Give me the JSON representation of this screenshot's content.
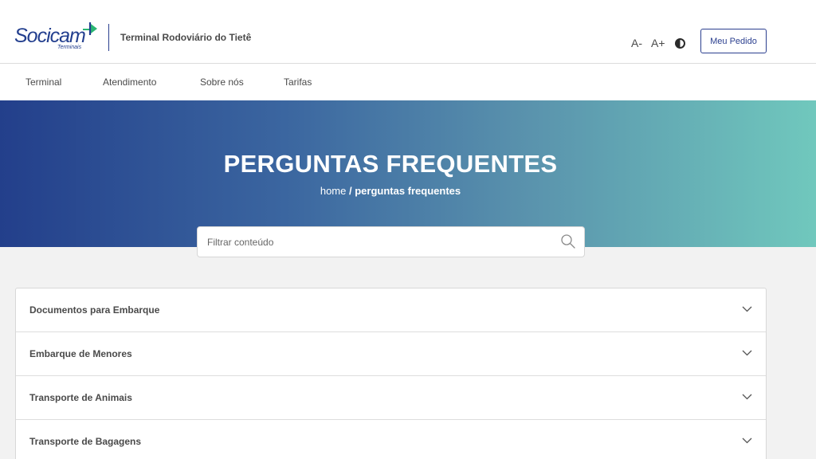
{
  "header": {
    "logo_text": "Socicam",
    "logo_subtext": "Terminais",
    "terminal_name": "Terminal Rodoviário do Tietê",
    "font_decrease": "A-",
    "font_increase": "A+",
    "order_button": "Meu Pedido"
  },
  "nav": {
    "items": [
      {
        "label": "Terminal"
      },
      {
        "label": "Atendimento"
      },
      {
        "label": "Sobre nós"
      },
      {
        "label": "Tarifas"
      }
    ]
  },
  "hero": {
    "title": "PERGUNTAS FREQUENTES",
    "breadcrumb_home": "home",
    "breadcrumb_separator": " / ",
    "breadcrumb_current": "perguntas frequentes"
  },
  "search": {
    "placeholder": "Filtrar conteúdo",
    "value": ""
  },
  "faq": {
    "items": [
      {
        "label": "Documentos para Embarque"
      },
      {
        "label": "Embarque de Menores"
      },
      {
        "label": "Transporte de Animais"
      },
      {
        "label": "Transporte de Bagagens"
      }
    ]
  },
  "colors": {
    "brand_blue": "#223e8e",
    "brand_green": "#2bb673",
    "hero_gradient_start": "#233f8b",
    "hero_gradient_end": "#70c8bd"
  }
}
